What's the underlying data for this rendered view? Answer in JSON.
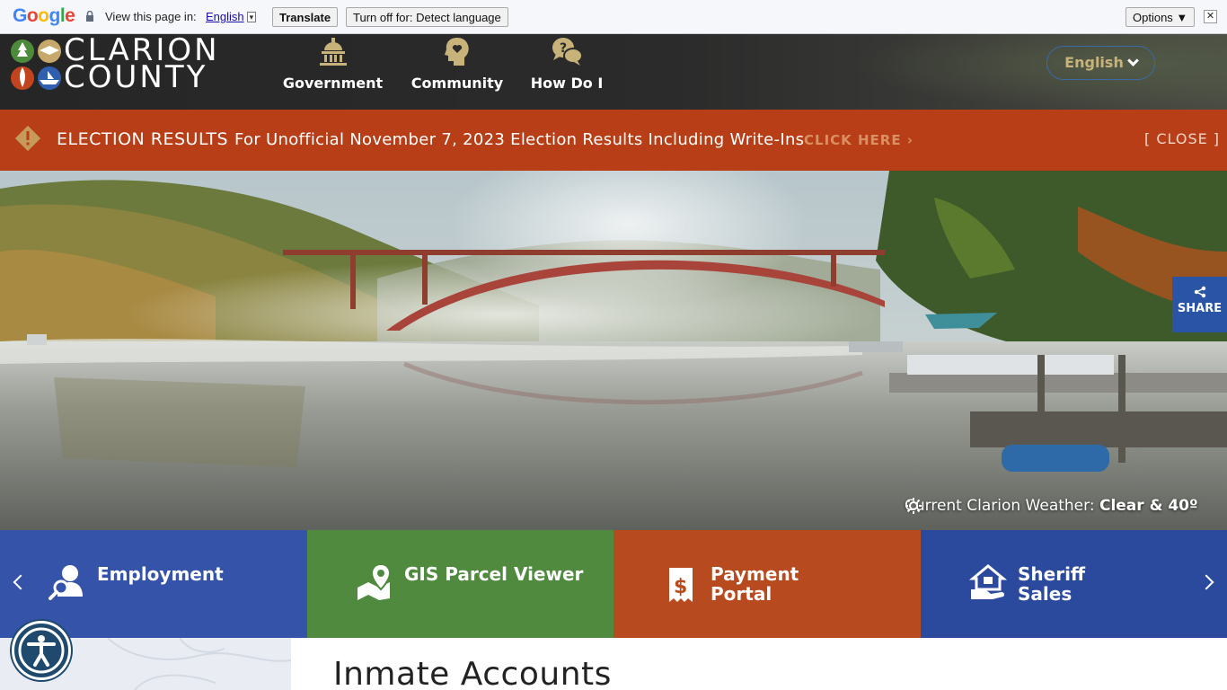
{
  "translate_bar": {
    "logo": "Google",
    "view_text": "View this page in:",
    "language": "English",
    "dropdown_glyph": "▾",
    "translate_label": "Translate",
    "turn_off_label": "Turn off for: Detect language",
    "options_label": "Options ▼",
    "close_glyph": "✕"
  },
  "header": {
    "logo_line1": "CLARION",
    "logo_line2": "COUNTY",
    "nav": [
      {
        "label": "Government",
        "icon": "capitol-icon"
      },
      {
        "label": "Community",
        "icon": "heart-head-icon"
      },
      {
        "label": "How Do I",
        "icon": "question-chat-icon"
      }
    ],
    "language_button": "English"
  },
  "alert": {
    "title": "ELECTION RESULTS",
    "message": "For Unofficial November 7, 2023 Election Results Including Write-Ins",
    "link": "CLICK HERE ›",
    "close": "[ CLOSE ]"
  },
  "hero": {
    "weather_prefix": "Current Clarion Weather:",
    "weather_value": "Clear & 40º",
    "share_label": "SHARE"
  },
  "quick_links": [
    {
      "label": "Employment",
      "icon": "user-search-icon"
    },
    {
      "label": "GIS Parcel Viewer",
      "icon": "map-pin-icon"
    },
    {
      "label_line1": "Payment",
      "label_line2": "Portal",
      "icon": "receipt-dollar-icon"
    },
    {
      "label_line1": "Sheriff",
      "label_line2": "Sales",
      "icon": "house-hand-icon"
    }
  ],
  "page": {
    "title": "Inmate Accounts"
  },
  "colors": {
    "alert_bg": "#b83e17",
    "employment": "#3553a8",
    "gis": "#4f8a3e",
    "payment": "#b84a1f",
    "sheriff": "#2b4a9e",
    "accent_gold": "#c7b37a"
  }
}
